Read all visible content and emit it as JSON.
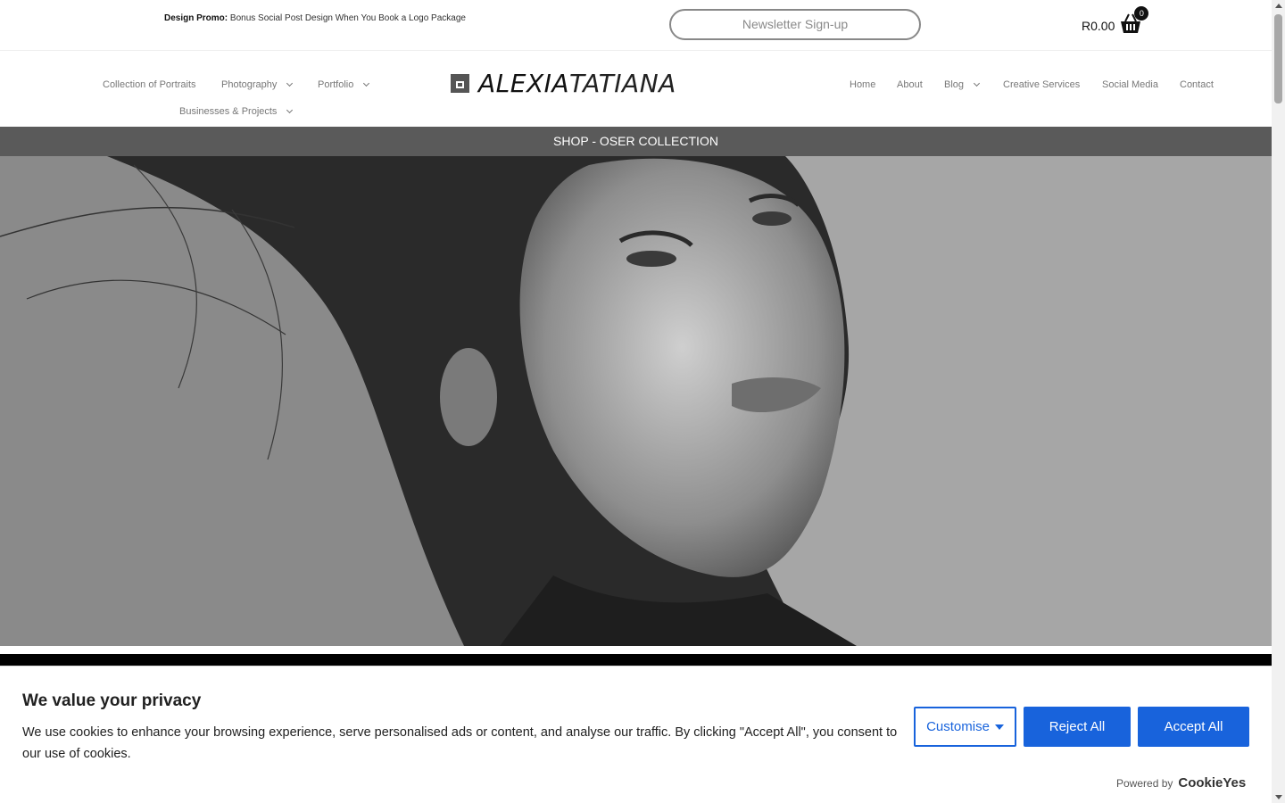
{
  "promo": {
    "label": "Design Promo:",
    "text": " Bonus Social Post Design When You Book a Logo Package"
  },
  "newsletter_label": "Newsletter Sign-up",
  "cart": {
    "total": "R0.00",
    "count": "0"
  },
  "nav_left": [
    {
      "label": "Collection of Portraits",
      "dropdown": false
    },
    {
      "label": "Photography",
      "dropdown": true
    },
    {
      "label": "Portfolio",
      "dropdown": true
    },
    {
      "label": "Businesses & Projects",
      "dropdown": true
    }
  ],
  "logo": {
    "bold": "ALEXIA",
    "light": "TATIANA"
  },
  "nav_right": [
    {
      "label": "Home",
      "dropdown": false
    },
    {
      "label": "About",
      "dropdown": false
    },
    {
      "label": "Blog",
      "dropdown": true
    },
    {
      "label": "Creative Services",
      "dropdown": false
    },
    {
      "label": "Social Media",
      "dropdown": false
    },
    {
      "label": "Contact",
      "dropdown": false
    }
  ],
  "shop_banner": "SHOP - OSER COLLECTION",
  "cookie": {
    "title": "We value your privacy",
    "text": "We use cookies to enhance your browsing experience, serve personalised ads or content, and analyse our traffic. By clicking \"Accept All\", you consent to our use of cookies.",
    "customise": "Customise",
    "reject": "Reject All",
    "accept": "Accept All",
    "powered_by": "Powered by",
    "brand": "CookieYes"
  },
  "colors": {
    "accent": "#1863dc",
    "banner": "#5a5a5a"
  }
}
